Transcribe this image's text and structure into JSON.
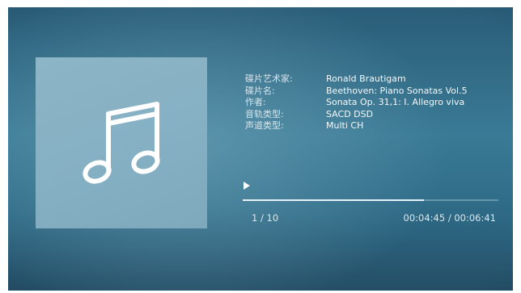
{
  "track_info": {
    "rows": [
      {
        "label": "碟片艺术家:",
        "value": "Ronald Brautigam"
      },
      {
        "label": "碟片名:",
        "value": "Beethoven: Piano Sonatas Vol.5"
      },
      {
        "label": "作者:",
        "value": "Sonata Op. 31,1: I. Allegro viva"
      },
      {
        "label": "音轨类型:",
        "value": "SACD DSD"
      },
      {
        "label": "声道类型:",
        "value": "Multi CH"
      }
    ]
  },
  "playback": {
    "track_count": "1 / 10",
    "time": "00:04:45 / 00:06:41",
    "progress_fraction": 0.71
  },
  "icons": {
    "album_art": "music-note-icon",
    "play": "play-icon"
  },
  "colors": {
    "background": "#3a7a95",
    "album_art": "#86b0c3",
    "text": "#e6f1f6"
  }
}
